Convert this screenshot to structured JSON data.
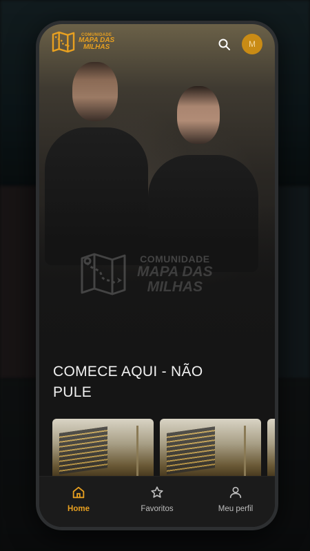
{
  "app": {
    "brand_top": "COMUNIDADE",
    "brand_main_line1": "MAPA DAS",
    "brand_main_line2": "MILHAS",
    "accent_color": "#e8a020"
  },
  "header": {
    "search_icon": "search-icon",
    "avatar_initial": "M"
  },
  "hero": {
    "brand_top": "COMUNIDADE",
    "brand_main_line1": "MAPA DAS",
    "brand_main_line2": "MILHAS"
  },
  "section": {
    "title": "COMECE AQUI - NÃO PULE"
  },
  "bottom_nav": {
    "items": [
      {
        "label": "Home",
        "icon": "home-icon",
        "active": true
      },
      {
        "label": "Favoritos",
        "icon": "star-icon",
        "active": false
      },
      {
        "label": "Meu perfil",
        "icon": "user-icon",
        "active": false
      }
    ]
  }
}
